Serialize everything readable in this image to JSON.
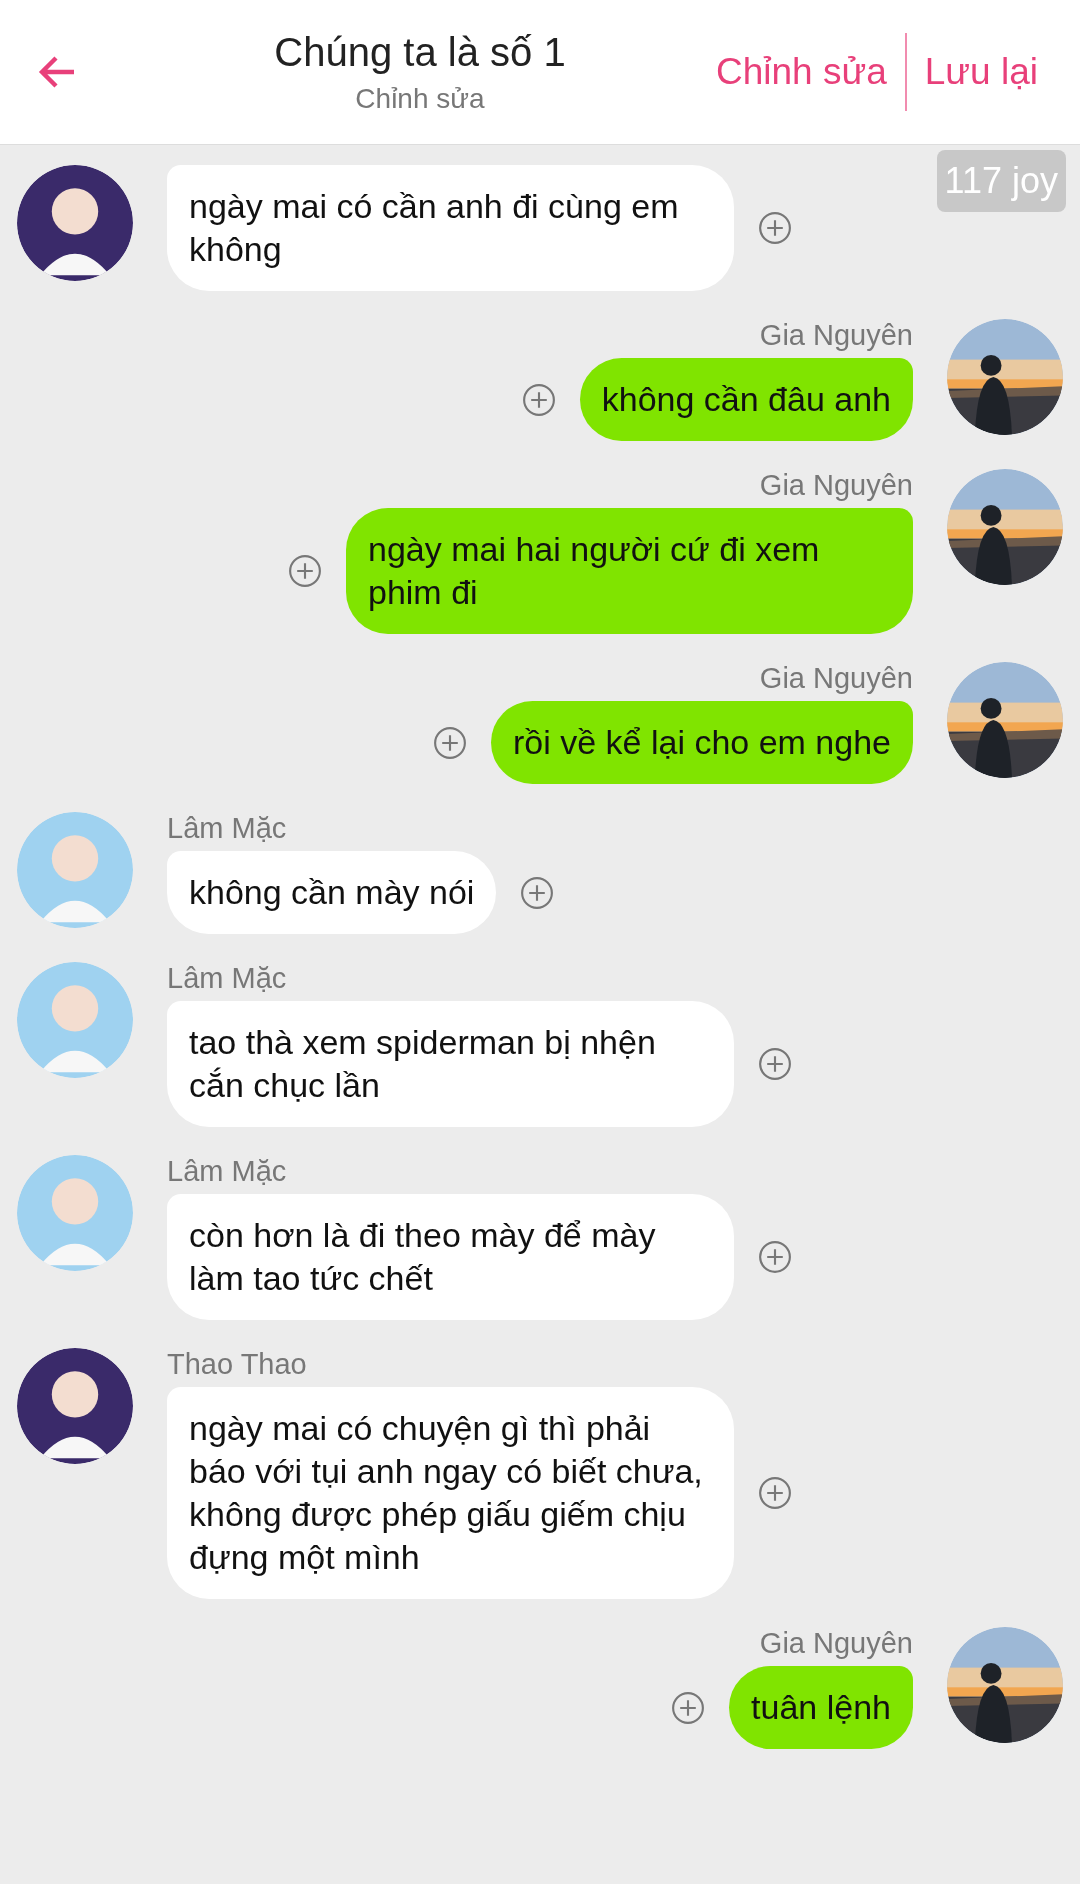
{
  "header": {
    "title": "Chúng ta là số 1",
    "subtitle": "Chỉnh sửa",
    "actions": [
      "Chỉnh sửa",
      "Lưu lại"
    ]
  },
  "badge": "117 joy",
  "messages": [
    {
      "kind": "incoming",
      "color": "#3a2a6a",
      "text": "ngày mai có cần anh đi cùng em không"
    },
    {
      "kind": "outgoing",
      "sender": "Gia Nguyên",
      "text": "không cần đâu anh"
    },
    {
      "kind": "outgoing",
      "sender": "Gia Nguyên",
      "text": "ngày mai hai người cứ đi xem phim đi"
    },
    {
      "kind": "outgoing",
      "sender": "Gia Nguyên",
      "text": "rồi về kể lại cho em nghe"
    },
    {
      "kind": "incoming",
      "color": "#9fd2f0",
      "sender": "Lâm Mặc",
      "text": "không cần mày nói"
    },
    {
      "kind": "incoming",
      "color": "#9fd2f0",
      "sender": "Lâm Mặc",
      "text": "tao thà xem spiderman bị nhện cắn chục lần"
    },
    {
      "kind": "incoming",
      "color": "#9fd2f0",
      "sender": "Lâm Mặc",
      "text": "còn hơn là đi theo mày để mày làm tao tức chết"
    },
    {
      "kind": "incoming",
      "color": "#3a2a6a",
      "sender": "Thao Thao",
      "text": "ngày mai có chuyện gì thì phải báo với tụi anh ngay có biết chưa, không được phép giấu giếm chịu đựng một mình"
    },
    {
      "kind": "outgoing",
      "sender": "Gia Nguyên",
      "text": "tuân lệnh"
    }
  ]
}
